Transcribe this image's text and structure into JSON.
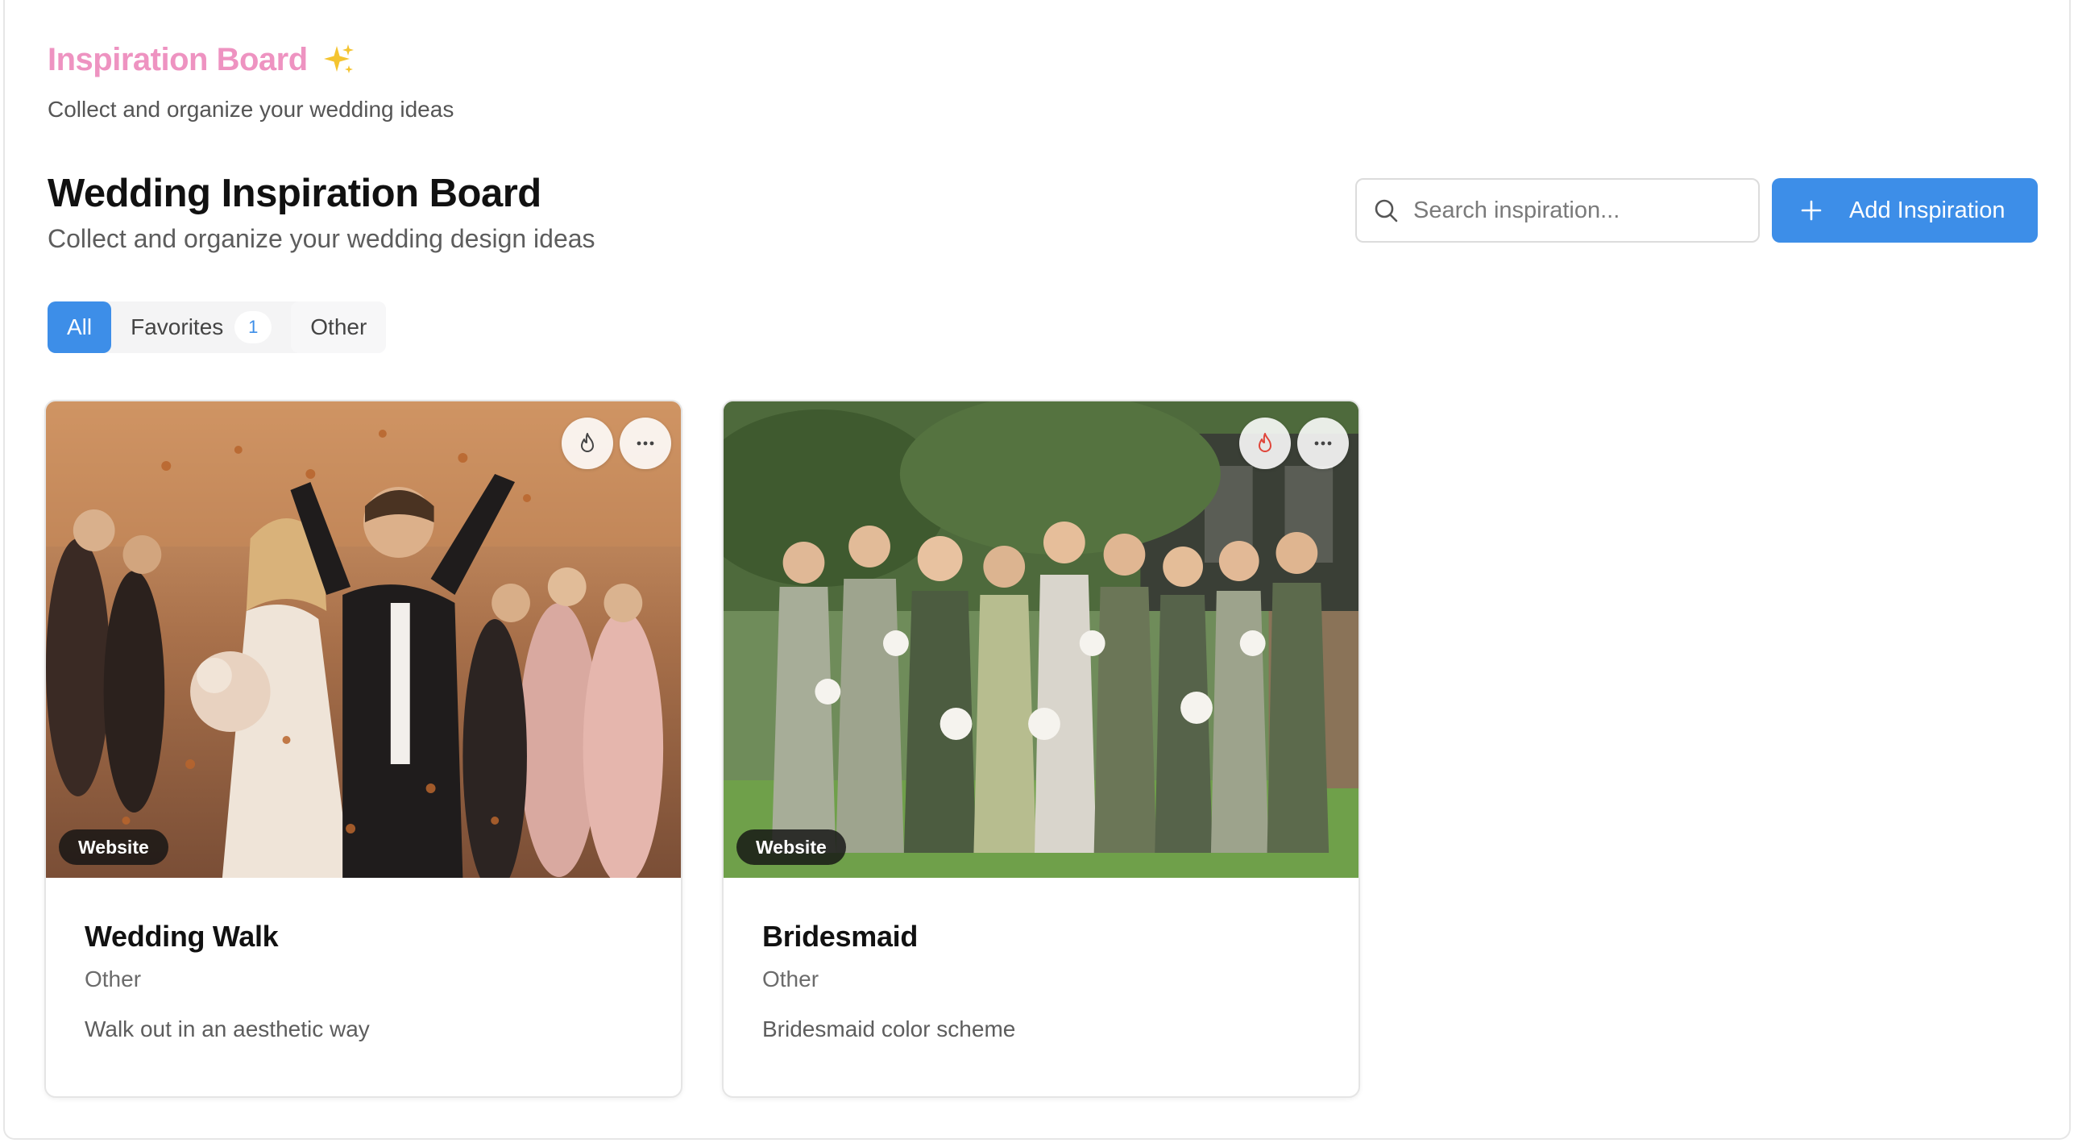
{
  "header": {
    "app_title": "Inspiration Board",
    "app_subtitle": "Collect and organize your wedding ideas",
    "board_title": "Wedding Inspiration Board",
    "board_subtitle": "Collect and organize your wedding design ideas"
  },
  "search": {
    "placeholder": "Search inspiration...",
    "value": ""
  },
  "actions": {
    "add_label": "Add Inspiration"
  },
  "tabs": [
    {
      "label": "All",
      "active": true
    },
    {
      "label": "Favorites",
      "count": "1"
    },
    {
      "label": "Other"
    }
  ],
  "cards": [
    {
      "title": "Wedding Walk",
      "category": "Other",
      "description": "Walk out in an aesthetic way",
      "source_badge": "Website",
      "favorite": false
    },
    {
      "title": "Bridesmaid",
      "category": "Other",
      "description": "Bridesmaid color scheme",
      "source_badge": "Website",
      "favorite": true
    }
  ],
  "colors": {
    "accent": "#3d8ee8",
    "brand_pink": "#ee93c1",
    "favorite_red": "#e0453a"
  },
  "icons": {
    "sparkle": "sparkles-icon",
    "search": "search-icon",
    "add": "plus-icon",
    "favorite": "flame-icon",
    "more": "more-horizontal-icon"
  }
}
